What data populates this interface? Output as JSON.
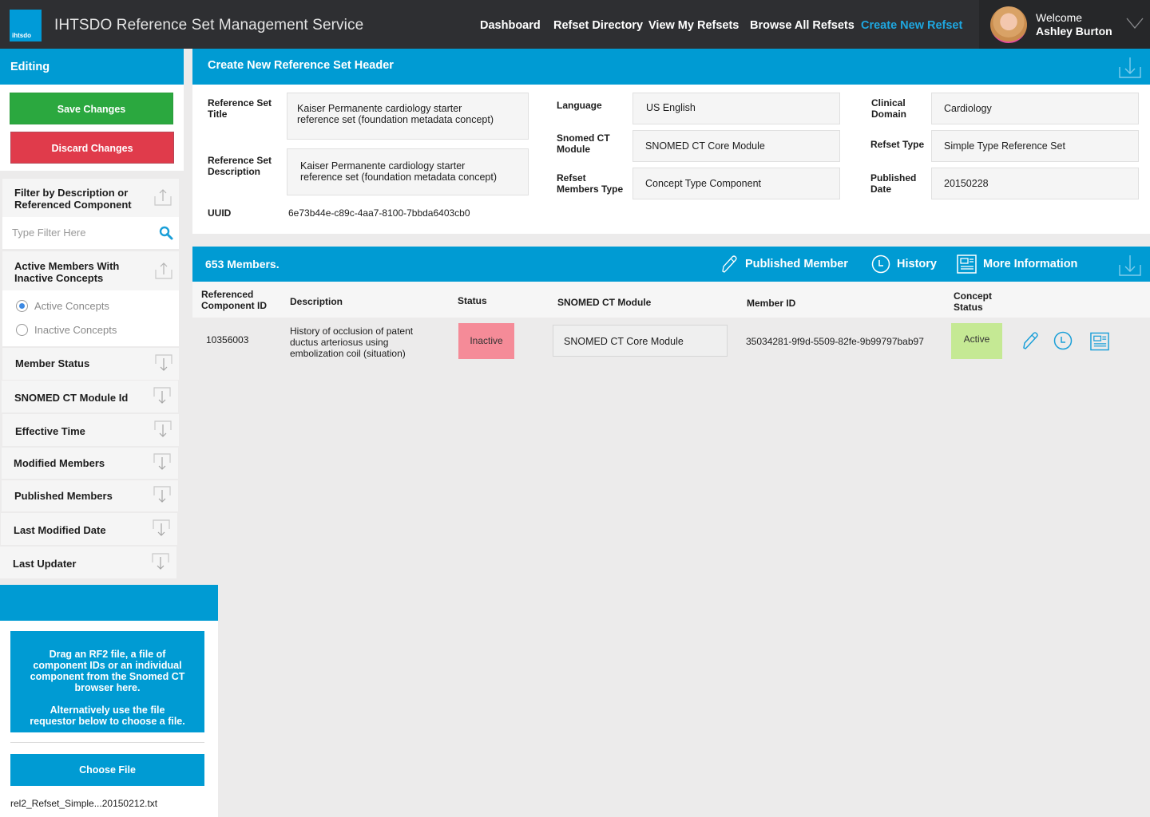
{
  "app": {
    "logo_text": "ihtsdo",
    "title": "IHTSDO Reference Set Management Service"
  },
  "nav": {
    "items": [
      {
        "label": "Dashboard",
        "active": false
      },
      {
        "label": "Refset Directory",
        "active": false
      },
      {
        "label": "View My Refsets",
        "active": false
      },
      {
        "label": "Browse All Refsets",
        "active": false
      },
      {
        "label": "Create New Refset",
        "active": true
      }
    ],
    "user": {
      "welcome": "Welcome",
      "name": "Ashley Burton"
    }
  },
  "sidebar": {
    "editing_title": "Editing",
    "save_label": "Save Changes",
    "discard_label": "Discard Changes",
    "filter": {
      "title": "Filter by Description or Referenced Component",
      "placeholder": "Type Filter Here",
      "value": ""
    },
    "active_members": {
      "title": "Active Members With Inactive Concepts",
      "options": [
        {
          "label": "Active Concepts",
          "selected": true
        },
        {
          "label": "Inactive Concepts",
          "selected": false
        }
      ]
    },
    "sections": [
      {
        "label": "Member Status"
      },
      {
        "label": "SNOMED CT Module Id"
      },
      {
        "label": "Effective Time"
      },
      {
        "label": "Modified Members"
      },
      {
        "label": "Published Members"
      },
      {
        "label": "Last Modified Date"
      },
      {
        "label": "Last Updater"
      }
    ],
    "upload": {
      "drop_text_1": "Drag an RF2 file, a file of component IDs or an individual component from the Snomed CT browser here.",
      "drop_text_2": "Alternatively use the file requestor below to choose a file.",
      "choose_label": "Choose File",
      "file_name": "rel2_Refset_Simple...20150212.txt"
    }
  },
  "header_card": {
    "title": "Create New Reference Set Header",
    "fields": {
      "title_label": "Reference Set Title",
      "title_value": "Kaiser Permanente cardiology starter reference set (foundation metadata concept)",
      "description_label": "Reference Set Description",
      "description_value": "Kaiser Permanente cardiology starter reference set (foundation metadata concept)",
      "uuid_label": "UUID",
      "uuid_value": "6e73b44e-c89c-4aa7-8100-7bbda6403cb0",
      "language_label": "Language",
      "language_value": "US English",
      "module_label": "Snomed CT Module",
      "module_value": "SNOMED CT Core Module",
      "members_type_label": "Refset Members Type",
      "members_type_value": "Concept Type Component",
      "domain_label": "Clinical Domain",
      "domain_value": "Cardiology",
      "refset_type_label": "Refset Type",
      "refset_type_value": "Simple Type Reference Set",
      "published_label": "Published Date",
      "published_value": "20150228"
    }
  },
  "members": {
    "count_label": "653 Members.",
    "actions": {
      "published": "Published Member",
      "history": "History",
      "more_info": "More Information"
    },
    "columns": [
      "Referenced Component ID",
      "Description",
      "Status",
      "SNOMED CT Module",
      "Member ID",
      "Concept Status"
    ],
    "rows": [
      {
        "component_id": "10356003",
        "description": "History of occlusion of patent ductus arteriosus using embolization coil (situation)",
        "status": "Inactive",
        "module": "SNOMED CT Core Module",
        "member_id": "35034281-9f9d-5509-82fe-9b99797bab97",
        "concept_status": "Active"
      }
    ]
  },
  "colors": {
    "brand_blue": "#009bd3",
    "nav_bg": "#2e2f32",
    "save_green": "#2ba83f",
    "discard_red": "#e03b4b",
    "inactive_pink": "#f58b98",
    "active_green": "#c5e994",
    "nav_active": "#1ea7e0"
  }
}
